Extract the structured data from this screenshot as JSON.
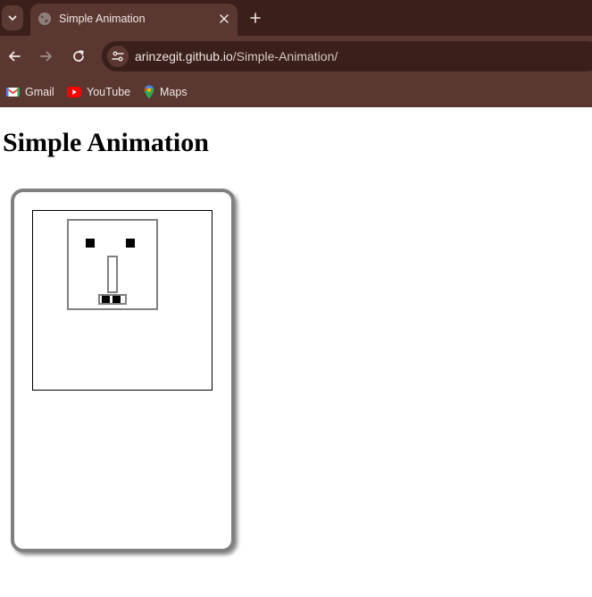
{
  "browser": {
    "tab": {
      "title": "Simple Animation"
    },
    "address_bar": {
      "domain": "arinzegit.github.io",
      "path": "/Simple-Animation/"
    },
    "bookmarks": [
      {
        "label": "Gmail",
        "icon": "gmail-icon"
      },
      {
        "label": "YouTube",
        "icon": "youtube-icon"
      },
      {
        "label": "Maps",
        "icon": "maps-icon"
      }
    ],
    "colors": {
      "tabstrip": "#3a1f1a",
      "toolbar": "#5a3831",
      "text": "#f1e6e3"
    }
  },
  "page": {
    "heading": "Simple Animation"
  }
}
